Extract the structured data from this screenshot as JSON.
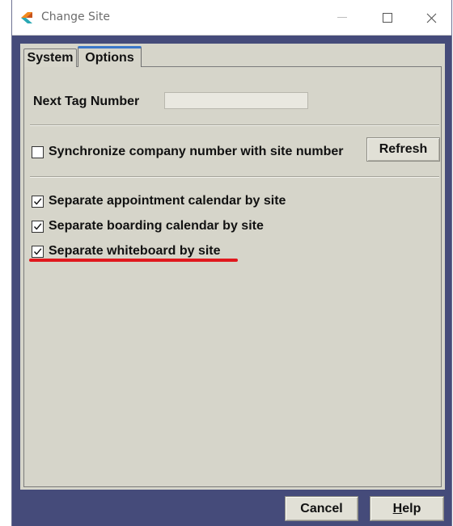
{
  "window": {
    "title": "Change Site",
    "controls": {
      "minimize": "—",
      "maximize": "☐",
      "close": "✕"
    }
  },
  "tabs": [
    {
      "label": "System",
      "active": false
    },
    {
      "label": "Options",
      "active": true
    }
  ],
  "options": {
    "next_tag_label": "Next Tag Number",
    "next_tag_value": "",
    "sync_label": "Synchronize company number with site number",
    "sync_checked": false,
    "refresh_label": "Refresh",
    "checkboxes": [
      {
        "label": "Separate appointment calendar by site",
        "checked": true
      },
      {
        "label": "Separate boarding calendar by site",
        "checked": true
      },
      {
        "label": "Separate whiteboard by site",
        "checked": true
      }
    ]
  },
  "footer": {
    "cancel_label": "Cancel",
    "help_label": "Help",
    "help_mnemonic": "H",
    "help_rest": "elp"
  },
  "colors": {
    "frame": "#454b7a",
    "panel": "#d6d5ca",
    "active_tab_accent": "#3a77c9",
    "highlight_underline": "#e0181d"
  }
}
